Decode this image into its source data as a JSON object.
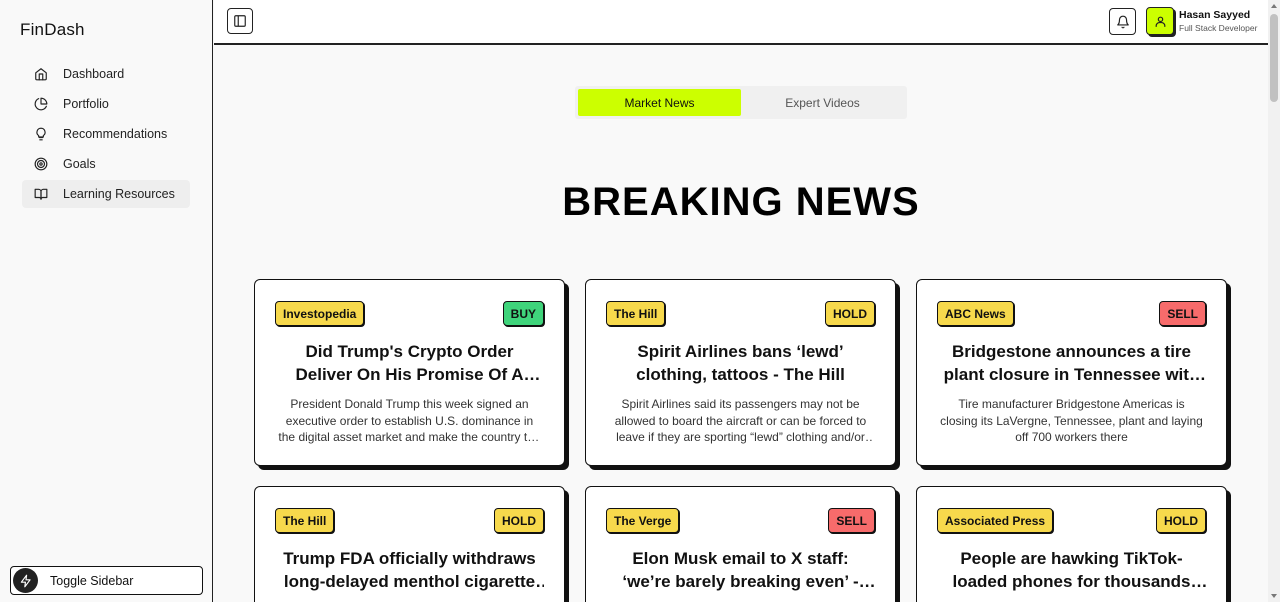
{
  "app": {
    "brand": "FinDash"
  },
  "sidebar": {
    "items": [
      {
        "label": "Dashboard",
        "icon": "home-icon"
      },
      {
        "label": "Portfolio",
        "icon": "pie-chart-icon"
      },
      {
        "label": "Recommendations",
        "icon": "lightbulb-icon"
      },
      {
        "label": "Goals",
        "icon": "target-icon"
      },
      {
        "label": "Learning Resources",
        "icon": "book-open-icon",
        "active": true
      }
    ],
    "toggle_label": "Toggle Sidebar"
  },
  "header": {
    "user_name": "Hasan Sayyed",
    "user_role": "Full Stack Developer"
  },
  "tabs": [
    {
      "label": "Market News",
      "active": true
    },
    {
      "label": "Expert Videos",
      "active": false
    }
  ],
  "headline": "BREAKING NEWS",
  "cards": [
    {
      "source": "Investopedia",
      "recommendation": "BUY",
      "title": "Did Trump's Crypto Order Deliver On His Promise Of A Bitcoin Reserve?",
      "description": "President Donald Trump this week signed an executive order to establish U.S. dominance in the digital asset market and make the country the crypto capital of the planet."
    },
    {
      "source": "The Hill",
      "recommendation": "HOLD",
      "title": "Spirit Airlines bans ‘lewd’ clothing, tattoos - The Hill",
      "description": "Spirit Airlines said its passengers may not be allowed to board the aircraft or can be forced to leave if they are sporting “lewd” clothing and/or offensive tattoos."
    },
    {
      "source": "ABC News",
      "recommendation": "SELL",
      "title": "Bridgestone announces a tire plant closure in Tennessee with layoffs",
      "description": "Tire manufacturer Bridgestone Americas is closing its LaVergne, Tennessee, plant and laying off 700 workers there"
    },
    {
      "source": "The Hill",
      "recommendation": "HOLD",
      "title": "Trump FDA officially withdraws long-delayed menthol cigarette ban",
      "description": ""
    },
    {
      "source": "The Verge",
      "recommendation": "SELL",
      "title": "Elon Musk email to X staff: ‘we’re barely breaking even’ - The Verge",
      "description": ""
    },
    {
      "source": "Associated Press",
      "recommendation": "HOLD",
      "title": "People are hawking TikTok-loaded phones for thousands online",
      "description": ""
    }
  ],
  "colors": {
    "accent": "#ccff00",
    "badge_yellow": "#f7d94c",
    "buy_green": "#3fd47b",
    "sell_red": "#f76b6b"
  }
}
